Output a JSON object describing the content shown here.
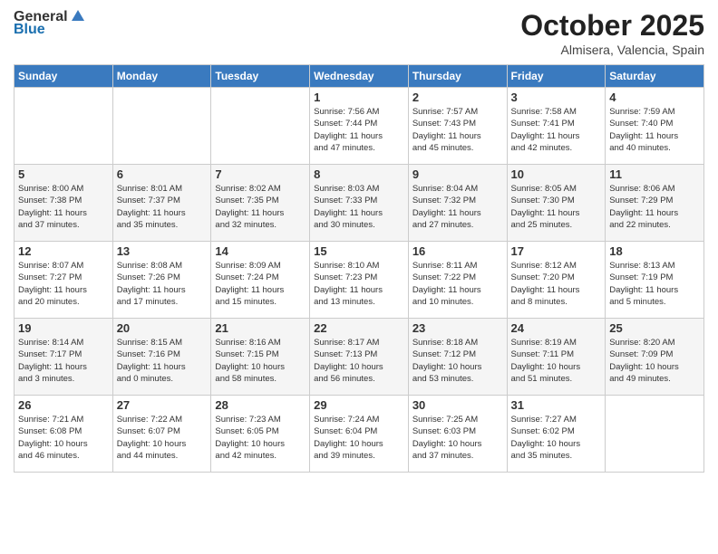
{
  "header": {
    "logo_general": "General",
    "logo_blue": "Blue",
    "month": "October 2025",
    "location": "Almisera, Valencia, Spain"
  },
  "weekdays": [
    "Sunday",
    "Monday",
    "Tuesday",
    "Wednesday",
    "Thursday",
    "Friday",
    "Saturday"
  ],
  "weeks": [
    [
      {
        "day": "",
        "info": ""
      },
      {
        "day": "",
        "info": ""
      },
      {
        "day": "",
        "info": ""
      },
      {
        "day": "1",
        "info": "Sunrise: 7:56 AM\nSunset: 7:44 PM\nDaylight: 11 hours\nand 47 minutes."
      },
      {
        "day": "2",
        "info": "Sunrise: 7:57 AM\nSunset: 7:43 PM\nDaylight: 11 hours\nand 45 minutes."
      },
      {
        "day": "3",
        "info": "Sunrise: 7:58 AM\nSunset: 7:41 PM\nDaylight: 11 hours\nand 42 minutes."
      },
      {
        "day": "4",
        "info": "Sunrise: 7:59 AM\nSunset: 7:40 PM\nDaylight: 11 hours\nand 40 minutes."
      }
    ],
    [
      {
        "day": "5",
        "info": "Sunrise: 8:00 AM\nSunset: 7:38 PM\nDaylight: 11 hours\nand 37 minutes."
      },
      {
        "day": "6",
        "info": "Sunrise: 8:01 AM\nSunset: 7:37 PM\nDaylight: 11 hours\nand 35 minutes."
      },
      {
        "day": "7",
        "info": "Sunrise: 8:02 AM\nSunset: 7:35 PM\nDaylight: 11 hours\nand 32 minutes."
      },
      {
        "day": "8",
        "info": "Sunrise: 8:03 AM\nSunset: 7:33 PM\nDaylight: 11 hours\nand 30 minutes."
      },
      {
        "day": "9",
        "info": "Sunrise: 8:04 AM\nSunset: 7:32 PM\nDaylight: 11 hours\nand 27 minutes."
      },
      {
        "day": "10",
        "info": "Sunrise: 8:05 AM\nSunset: 7:30 PM\nDaylight: 11 hours\nand 25 minutes."
      },
      {
        "day": "11",
        "info": "Sunrise: 8:06 AM\nSunset: 7:29 PM\nDaylight: 11 hours\nand 22 minutes."
      }
    ],
    [
      {
        "day": "12",
        "info": "Sunrise: 8:07 AM\nSunset: 7:27 PM\nDaylight: 11 hours\nand 20 minutes."
      },
      {
        "day": "13",
        "info": "Sunrise: 8:08 AM\nSunset: 7:26 PM\nDaylight: 11 hours\nand 17 minutes."
      },
      {
        "day": "14",
        "info": "Sunrise: 8:09 AM\nSunset: 7:24 PM\nDaylight: 11 hours\nand 15 minutes."
      },
      {
        "day": "15",
        "info": "Sunrise: 8:10 AM\nSunset: 7:23 PM\nDaylight: 11 hours\nand 13 minutes."
      },
      {
        "day": "16",
        "info": "Sunrise: 8:11 AM\nSunset: 7:22 PM\nDaylight: 11 hours\nand 10 minutes."
      },
      {
        "day": "17",
        "info": "Sunrise: 8:12 AM\nSunset: 7:20 PM\nDaylight: 11 hours\nand 8 minutes."
      },
      {
        "day": "18",
        "info": "Sunrise: 8:13 AM\nSunset: 7:19 PM\nDaylight: 11 hours\nand 5 minutes."
      }
    ],
    [
      {
        "day": "19",
        "info": "Sunrise: 8:14 AM\nSunset: 7:17 PM\nDaylight: 11 hours\nand 3 minutes."
      },
      {
        "day": "20",
        "info": "Sunrise: 8:15 AM\nSunset: 7:16 PM\nDaylight: 11 hours\nand 0 minutes."
      },
      {
        "day": "21",
        "info": "Sunrise: 8:16 AM\nSunset: 7:15 PM\nDaylight: 10 hours\nand 58 minutes."
      },
      {
        "day": "22",
        "info": "Sunrise: 8:17 AM\nSunset: 7:13 PM\nDaylight: 10 hours\nand 56 minutes."
      },
      {
        "day": "23",
        "info": "Sunrise: 8:18 AM\nSunset: 7:12 PM\nDaylight: 10 hours\nand 53 minutes."
      },
      {
        "day": "24",
        "info": "Sunrise: 8:19 AM\nSunset: 7:11 PM\nDaylight: 10 hours\nand 51 minutes."
      },
      {
        "day": "25",
        "info": "Sunrise: 8:20 AM\nSunset: 7:09 PM\nDaylight: 10 hours\nand 49 minutes."
      }
    ],
    [
      {
        "day": "26",
        "info": "Sunrise: 7:21 AM\nSunset: 6:08 PM\nDaylight: 10 hours\nand 46 minutes."
      },
      {
        "day": "27",
        "info": "Sunrise: 7:22 AM\nSunset: 6:07 PM\nDaylight: 10 hours\nand 44 minutes."
      },
      {
        "day": "28",
        "info": "Sunrise: 7:23 AM\nSunset: 6:05 PM\nDaylight: 10 hours\nand 42 minutes."
      },
      {
        "day": "29",
        "info": "Sunrise: 7:24 AM\nSunset: 6:04 PM\nDaylight: 10 hours\nand 39 minutes."
      },
      {
        "day": "30",
        "info": "Sunrise: 7:25 AM\nSunset: 6:03 PM\nDaylight: 10 hours\nand 37 minutes."
      },
      {
        "day": "31",
        "info": "Sunrise: 7:27 AM\nSunset: 6:02 PM\nDaylight: 10 hours\nand 35 minutes."
      },
      {
        "day": "",
        "info": ""
      }
    ]
  ]
}
